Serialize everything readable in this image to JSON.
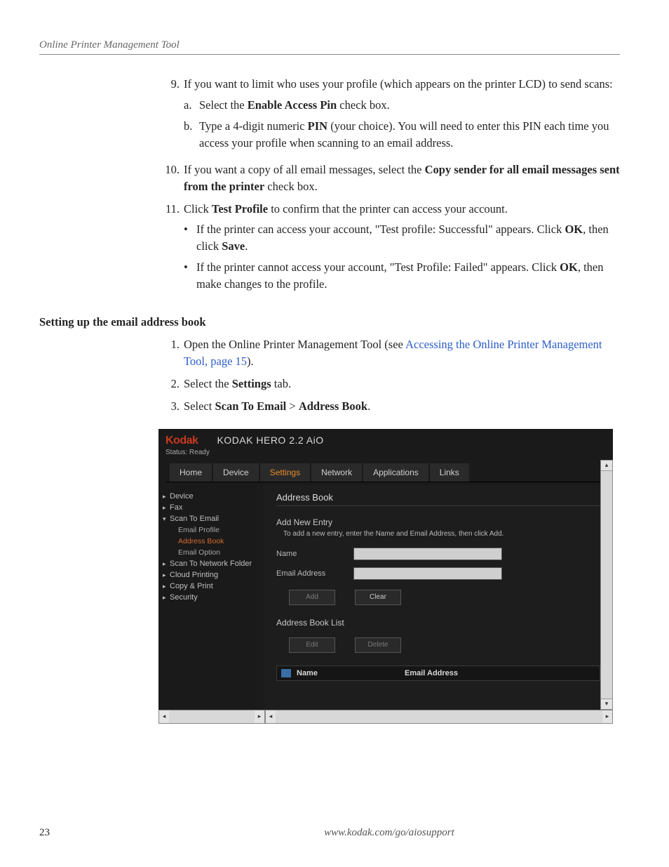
{
  "header": "Online Printer Management Tool",
  "steps": {
    "s9": {
      "num": "9.",
      "text_a": "If you want to limit who uses your profile (which appears on the printer LCD) to send scans:"
    },
    "s9a": {
      "mk": "a.",
      "p1": "Select the ",
      "b": "Enable Access Pin",
      "p2": " check box."
    },
    "s9b": {
      "mk": "b.",
      "p1": "Type a 4-digit numeric ",
      "b": "PIN",
      "p2": " (your choice). You will need to enter this PIN each time you access your profile when scanning to an email address."
    },
    "s10": {
      "num": "10.",
      "p1": "If you want a copy of all email messages, select the ",
      "b": "Copy sender for all email messages sent from the printer",
      "p2": " check box."
    },
    "s11": {
      "num": "11.",
      "p1": "Click ",
      "b": "Test Profile",
      "p2": " to confirm that the printer can access your account."
    },
    "s11b1": {
      "p1": "If the printer can access your account, \"Test profile: Successful\" appears. Click ",
      "b1": "OK",
      "p2": ", then click ",
      "b2": "Save",
      "p3": "."
    },
    "s11b2": {
      "p1": "If the printer cannot access your account, \"Test Profile: Failed\" appears. Click ",
      "b1": "OK",
      "p2": ", then make changes to the profile."
    }
  },
  "section": {
    "title": "Setting up the email address book"
  },
  "steps2": {
    "s1": {
      "num": "1.",
      "p1": "Open the Online Printer Management Tool (see ",
      "link": "Accessing the Online Printer Management Tool, page 15",
      "p2": ")."
    },
    "s2": {
      "num": "2.",
      "p1": "Select the ",
      "b": "Settings",
      "p2": " tab."
    },
    "s3": {
      "num": "3.",
      "p1": "Select ",
      "b1": "Scan To Email",
      "gt": " > ",
      "b2": "Address Book",
      "p2": "."
    }
  },
  "shot": {
    "brand": "Kodak",
    "model": "KODAK HERO 2.2 AiO",
    "status": "Status: Ready",
    "tabs": [
      "Home",
      "Device",
      "Settings",
      "Network",
      "Applications",
      "Links"
    ],
    "side": {
      "device": "Device",
      "fax": "Fax",
      "ste": "Scan To Email",
      "ep": "Email Profile",
      "ab": "Address Book",
      "eo": "Email Option",
      "stn": "Scan To Network Folder",
      "cp": "Cloud Printing",
      "cpp": "Copy & Print",
      "sec": "Security"
    },
    "main": {
      "title": "Address Book",
      "add": "Add New Entry",
      "hint": "To add a new entry, enter the Name and Email Address, then click Add.",
      "name": "Name",
      "email": "Email Address",
      "btnAdd": "Add",
      "btnClear": "Clear",
      "list": "Address Book List",
      "btnEdit": "Edit",
      "btnDelete": "Delete",
      "thName": "Name",
      "thEmail": "Email Address"
    }
  },
  "footer": {
    "page": "23",
    "url": "www.kodak.com/go/aiosupport"
  }
}
